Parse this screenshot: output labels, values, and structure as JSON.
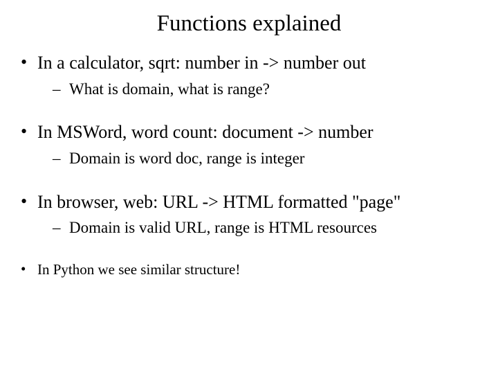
{
  "title": "Functions explained",
  "items": [
    {
      "text": "In a calculator, sqrt: number in -> number out",
      "sub": "What is domain, what is range?"
    },
    {
      "text": "In MSWord, word count: document -> number",
      "sub": "Domain is word doc, range is integer"
    },
    {
      "text": "In browser, web: URL -> HTML formatted \"page\"",
      "sub": "Domain is valid URL, range is HTML resources"
    },
    {
      "text": "In Python we see similar structure!",
      "sub": null
    }
  ]
}
